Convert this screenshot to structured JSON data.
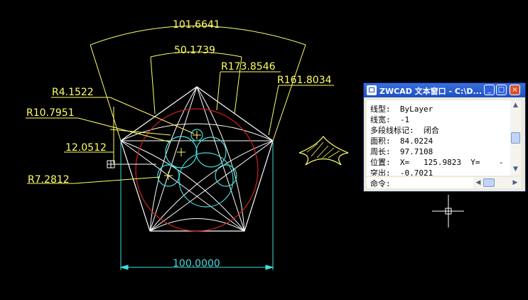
{
  "drawing": {
    "dims": {
      "arc_top": "101.6641",
      "arc_inner": "50.1739",
      "radius_large": "R173.8546",
      "radius_outer": "R161.8034",
      "r_small1": "R4.1522",
      "r_small2": "R10.7951",
      "linear_vert": "12.0512",
      "r_small3": "R7.2812",
      "bottom_width": "100.0000"
    },
    "colors": {
      "dimension": "#ffff66",
      "geometry": "#ffffff",
      "circles": "#44dddd",
      "arc_red": "#cc2222",
      "background": "#000000"
    }
  },
  "text_window": {
    "title": "ZWCAD 文本窗口 - C:\\D...",
    "buttons": {
      "minimize": "_",
      "maximize": "□",
      "close": "×"
    },
    "lines": [
      "线型:  ByLayer",
      "线宽:  -1",
      "多段线标记:  闭合",
      "面积:  84.0224",
      "周长:  97.7108",
      "位置:  X=   125.9823  Y=    -",
      "突出:  -0.7021"
    ],
    "command_label": "命令:"
  }
}
